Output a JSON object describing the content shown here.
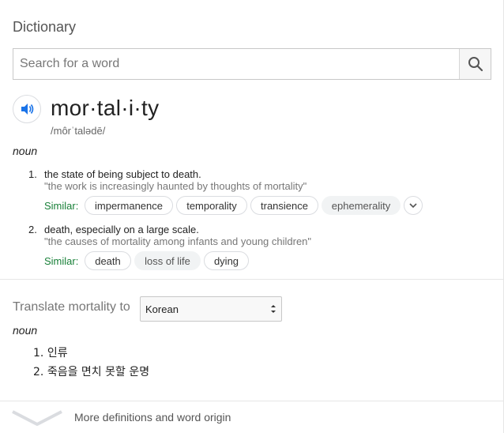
{
  "header": {
    "title": "Dictionary"
  },
  "search": {
    "placeholder": "Search for a word",
    "value": "",
    "button_icon": "search-icon"
  },
  "entry": {
    "word": "mor·tal·i·ty",
    "phonetic": "/môrˈtalədē/",
    "speaker_icon": "speaker-icon",
    "part_of_speech": "noun",
    "definitions": [
      {
        "number": "1.",
        "text": "the state of being subject to death.",
        "example": "\"the work is increasingly haunted by thoughts of mortality\"",
        "similar_label": "Similar:",
        "similar": [
          "impermanence",
          "temporality",
          "transience",
          "ephemerality"
        ]
      },
      {
        "number": "2.",
        "text": "death, especially on a large scale.",
        "example": "\"the causes of mortality among infants and young children\"",
        "similar_label": "Similar:",
        "similar": [
          "death",
          "loss of life",
          "dying"
        ]
      }
    ]
  },
  "translate": {
    "label": "Translate mortality to",
    "selected_language": "Korean",
    "part_of_speech": "noun",
    "items": [
      {
        "number": "1.",
        "text": "인류"
      },
      {
        "number": "2.",
        "text": "죽음을 면치 못할 운명"
      }
    ]
  },
  "footer": {
    "more_label": "More definitions and word origin",
    "chevron_icon": "chevron-down-icon"
  },
  "colors": {
    "similar": "#188038",
    "accent_blue": "#1a73e8"
  }
}
